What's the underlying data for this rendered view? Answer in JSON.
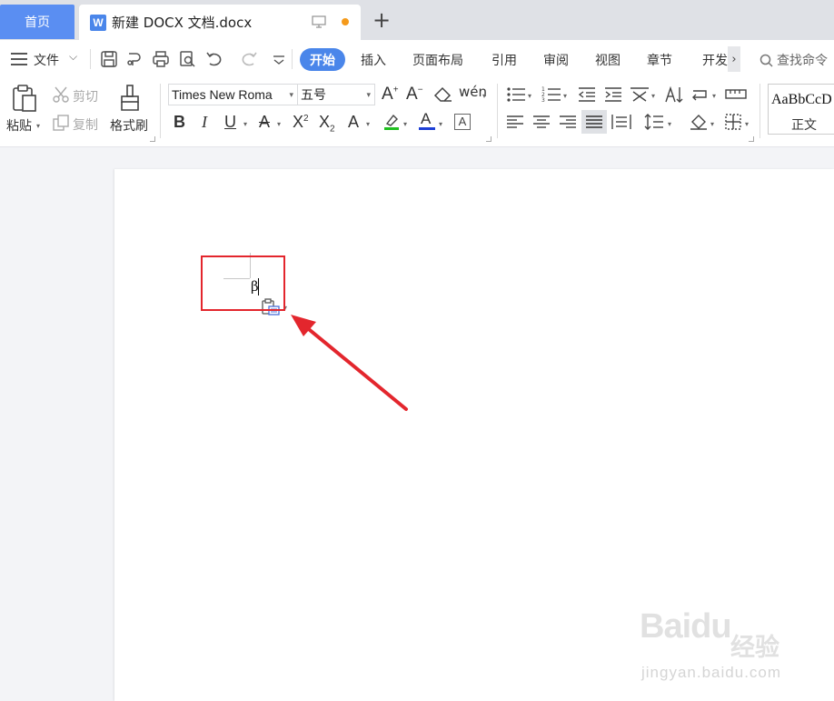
{
  "tabs": {
    "home": "首页",
    "doc_icon": "W",
    "doc_title": "新建 DOCX 文档.docx",
    "new_tab": "+"
  },
  "menu": {
    "file": "文件",
    "tabs": [
      "开始",
      "插入",
      "页面布局",
      "引用",
      "审阅",
      "视图",
      "章节",
      "开发"
    ],
    "active": "开始",
    "search": "查找命令"
  },
  "ribbon": {
    "paste": "粘贴",
    "cut": "剪切",
    "copy": "复制",
    "format_painter": "格式刷",
    "font_name": "Times New Roma",
    "font_size": "五号",
    "style_sample": "AaBbCcD",
    "style_name": "正文"
  },
  "document": {
    "text": "β"
  },
  "annotation": {
    "highlight_color": "#e3262d"
  },
  "watermark": {
    "logo": "Baidu",
    "name": "经验",
    "url": "jingyan.baidu.com"
  },
  "colors": {
    "accent": "#4a86ea",
    "modified_dot": "#f59a1b",
    "highlight_green": "#20c020",
    "font_color_blue": "#1d3fd6"
  }
}
